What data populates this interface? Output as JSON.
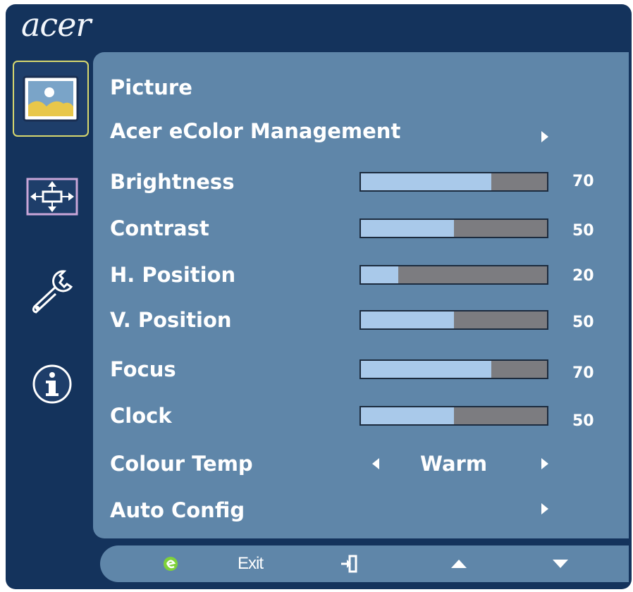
{
  "brand": "acer",
  "sidebar": {
    "items": [
      {
        "icon": "picture-icon",
        "active": true
      },
      {
        "icon": "position-icon",
        "active": false
      },
      {
        "icon": "settings-icon",
        "active": false
      },
      {
        "icon": "info-icon",
        "active": false
      }
    ]
  },
  "menu": {
    "title": "Picture",
    "ecolor": "Acer eColor Management",
    "sliders": [
      {
        "label": "Brightness",
        "value": 70
      },
      {
        "label": "Contrast",
        "value": 50
      },
      {
        "label": "H. Position",
        "value": 20
      },
      {
        "label": "V. Position",
        "value": 50
      },
      {
        "label": "Focus",
        "value": 70
      },
      {
        "label": "Clock",
        "value": 50
      }
    ],
    "colour_temp": {
      "label": "Colour Temp",
      "value": "Warm"
    },
    "auto_config": "Auto Config"
  },
  "bottom": {
    "exit_label": "Exit",
    "icons": [
      "eco-icon",
      "enter-icon",
      "up-arrow-icon",
      "down-arrow-icon"
    ]
  },
  "colors": {
    "frame": "#14335c",
    "panel": "#5f86a9",
    "bar_fill": "#a9c9ea",
    "bar_empty": "#7c7c80",
    "active_border": "#d8d86e"
  }
}
